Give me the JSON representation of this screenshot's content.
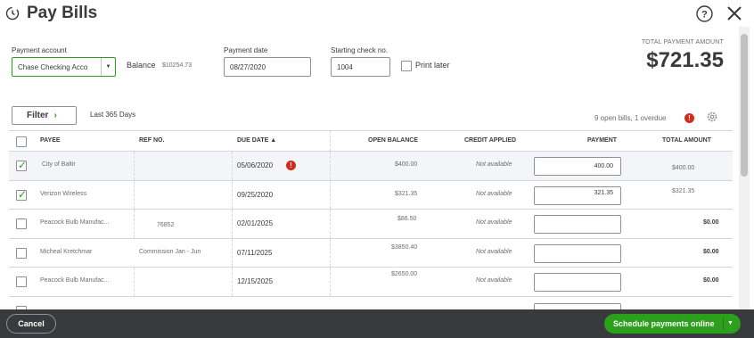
{
  "header": {
    "title": "Pay Bills",
    "clock_icon": "history-clock-icon",
    "help_icon": "help-icon",
    "close_icon": "close-icon"
  },
  "form": {
    "payment_account_label": "Payment account",
    "payment_account_value": "Chase Checking Acco",
    "balance_label": "Balance",
    "balance_value": "$10254.73",
    "payment_date_label": "Payment date",
    "payment_date_value": "08/27/2020",
    "starting_check_label": "Starting check no.",
    "starting_check_value": "1004",
    "print_later_label": "Print later"
  },
  "total": {
    "label": "TOTAL PAYMENT AMOUNT",
    "value": "$721.35"
  },
  "filter": {
    "button_label": "Filter",
    "range_label": "Last 365 Days",
    "open_bills": "9 open bills, 1 overdue"
  },
  "table": {
    "columns": [
      "PAYEE",
      "REF NO.",
      "DUE DATE ▲",
      "OPEN BALANCE",
      "CREDIT APPLIED",
      "PAYMENT",
      "TOTAL AMOUNT"
    ],
    "rows": [
      {
        "checked": true,
        "payee": "City of Baltir",
        "ref": "",
        "due": "05/06/2020",
        "overdue": true,
        "open_balance": "$400.00",
        "credit": "Not available",
        "payment": "400.00",
        "total": "$400.00"
      },
      {
        "checked": true,
        "payee": "Verizon Wireless",
        "ref": "",
        "due": "09/25/2020",
        "overdue": false,
        "open_balance": "$321.35",
        "credit": "Not available",
        "payment": "321.35",
        "total": "$321.35"
      },
      {
        "checked": false,
        "payee": "Peacock Bulb Manufac...",
        "ref": "76852",
        "due": "02/01/2025",
        "overdue": false,
        "open_balance": "$86.50",
        "credit": "Not available",
        "payment": "",
        "total": "$0.00"
      },
      {
        "checked": false,
        "payee": "Micheal Kretchmar",
        "ref": "Commission Jan - Jun",
        "due": "07/11/2025",
        "overdue": false,
        "open_balance": "$3850.40",
        "credit": "Not available",
        "payment": "",
        "total": "$0.00"
      },
      {
        "checked": false,
        "payee": "Peacock Bulb Manufac...",
        "ref": "",
        "due": "12/15/2025",
        "overdue": false,
        "open_balance": "$2650.00",
        "credit": "Not available",
        "payment": "",
        "total": "$0.00"
      }
    ]
  },
  "footer": {
    "cancel_label": "Cancel",
    "schedule_label": "Schedule payments online"
  },
  "colors": {
    "accent_green": "#2ca01c",
    "footer_bg": "#393a3d",
    "overdue_red": "#d52b1e"
  }
}
